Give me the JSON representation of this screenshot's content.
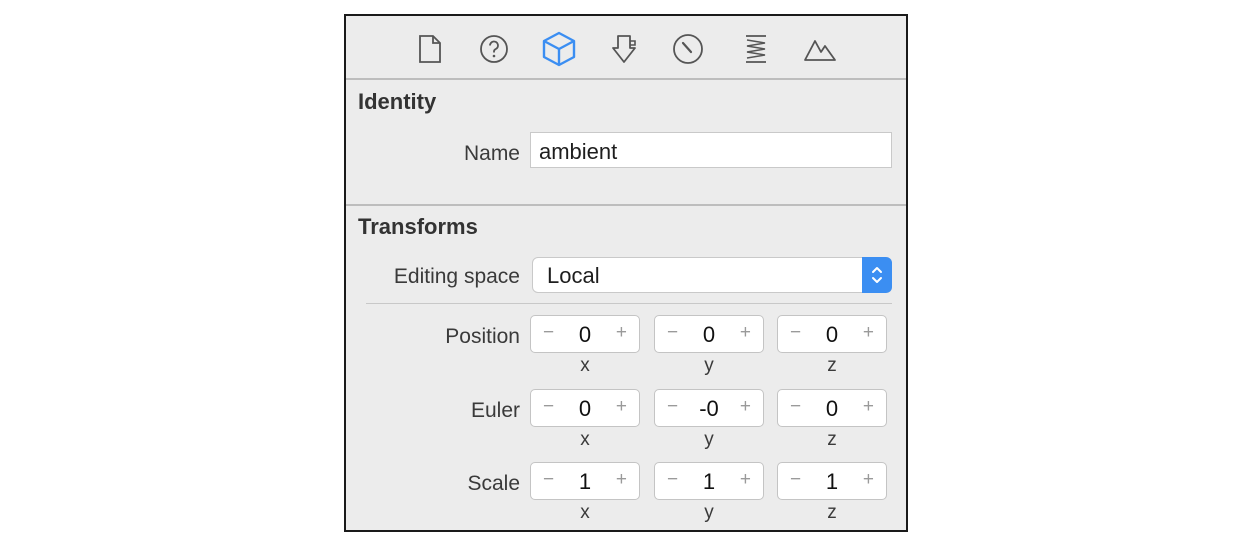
{
  "toolbar": {
    "icons": [
      "file-icon",
      "help-icon",
      "node-cube-icon",
      "attributes-icon",
      "physics-icon",
      "material-icon",
      "scene-icon"
    ],
    "active_icon": "node-cube-icon",
    "active_color": "#3b8ef2"
  },
  "identity": {
    "title": "Identity",
    "name_label": "Name",
    "name_value": "ambient"
  },
  "transforms": {
    "title": "Transforms",
    "editing_space_label": "Editing space",
    "editing_space_value": "Local",
    "rows": [
      {
        "label": "Position",
        "values": [
          "0",
          "0",
          "0"
        ]
      },
      {
        "label": "Euler",
        "values": [
          "0",
          "-0",
          "0"
        ]
      },
      {
        "label": "Scale",
        "values": [
          "1",
          "1",
          "1"
        ]
      }
    ],
    "axes": [
      "x",
      "y",
      "z"
    ],
    "minus_symbol": "−",
    "plus_symbol": "+"
  }
}
